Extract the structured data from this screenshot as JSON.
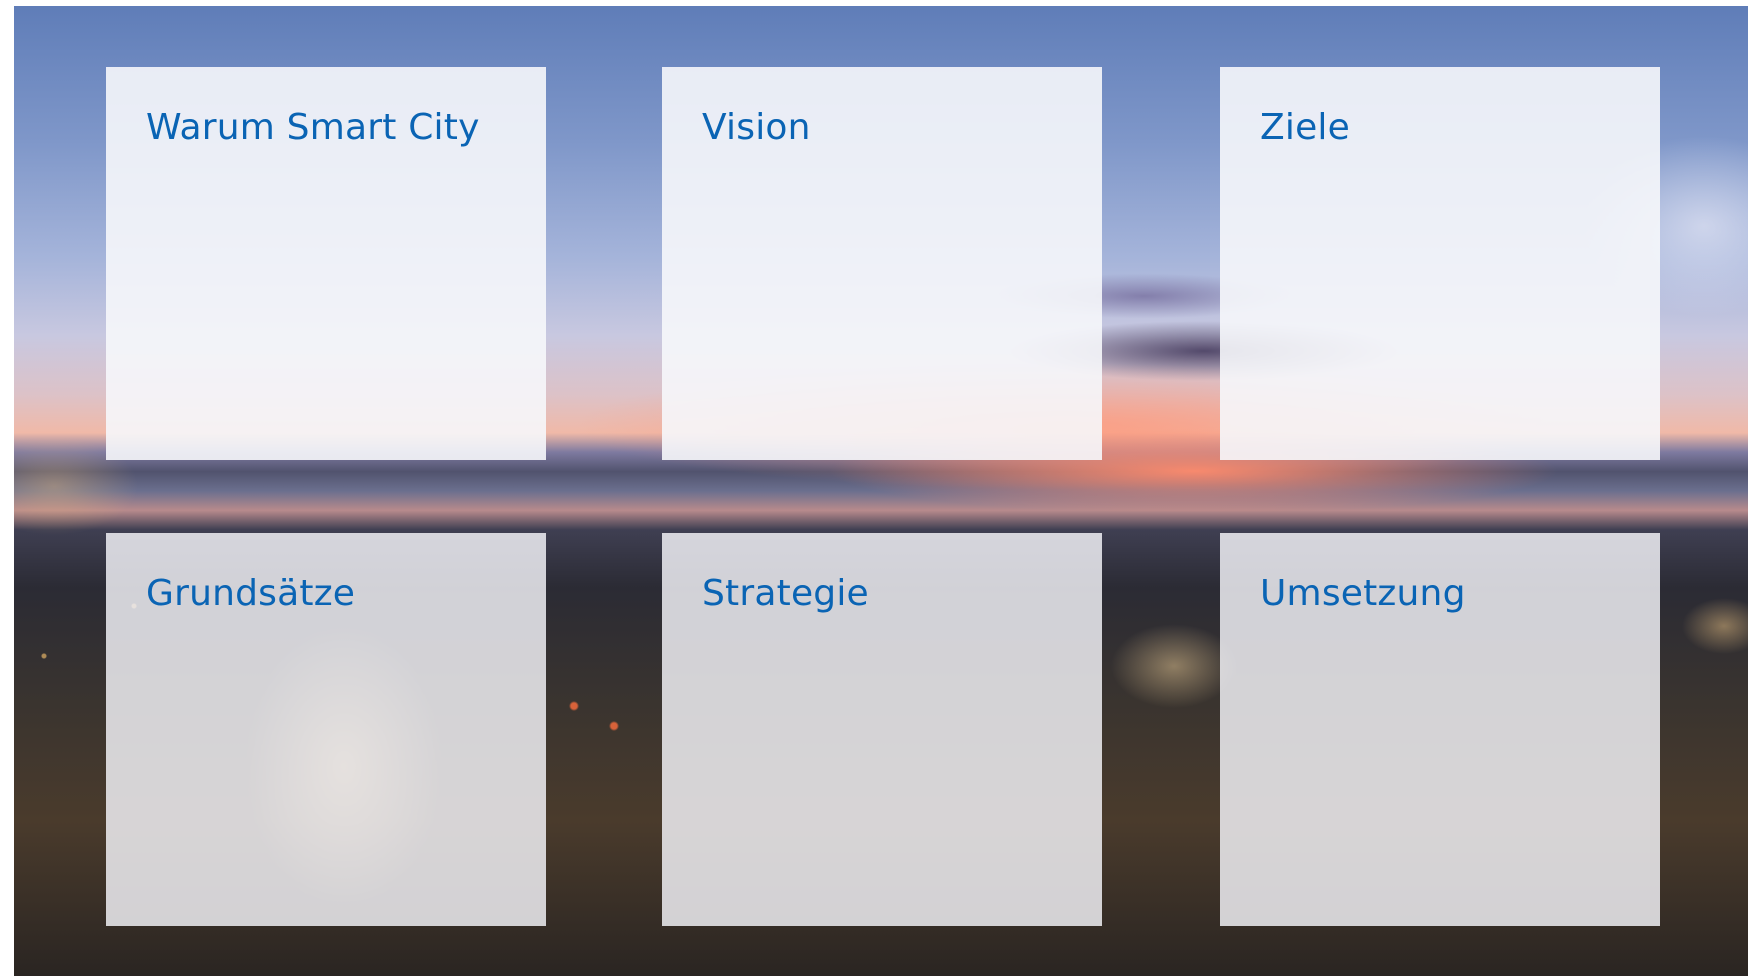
{
  "tiles": [
    {
      "title": "Warum Smart City"
    },
    {
      "title": "Vision"
    },
    {
      "title": "Ziele"
    },
    {
      "title": "Grundsätze"
    },
    {
      "title": "Strategie"
    },
    {
      "title": "Umsetzung"
    }
  ],
  "colors": {
    "tile_title": "#0a64b4",
    "tile_background": "#f6f7fb"
  }
}
